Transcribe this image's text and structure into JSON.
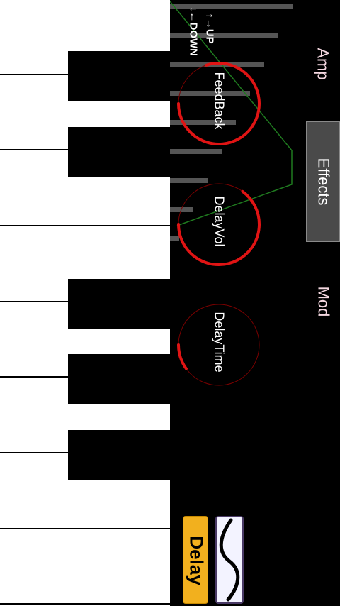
{
  "tabs": {
    "amp": "Amp",
    "effects": "Effects",
    "mod": "Mod"
  },
  "arrows": {
    "up": "↑→UP",
    "down": "↓←DOWN"
  },
  "knobs": [
    {
      "label": "FeedBack",
      "level": 0.8
    },
    {
      "label": "DelayVol",
      "level": 0.65
    },
    {
      "label": "DelayTime",
      "level": 0.1
    }
  ],
  "buttons": {
    "delay": "Delay",
    "waveform": "wave-icon"
  },
  "colors": {
    "knob": "#e01414",
    "accent": "#f2b01e",
    "tab_selected": "#4a4a4a",
    "envelope": "#1f7a1f"
  }
}
